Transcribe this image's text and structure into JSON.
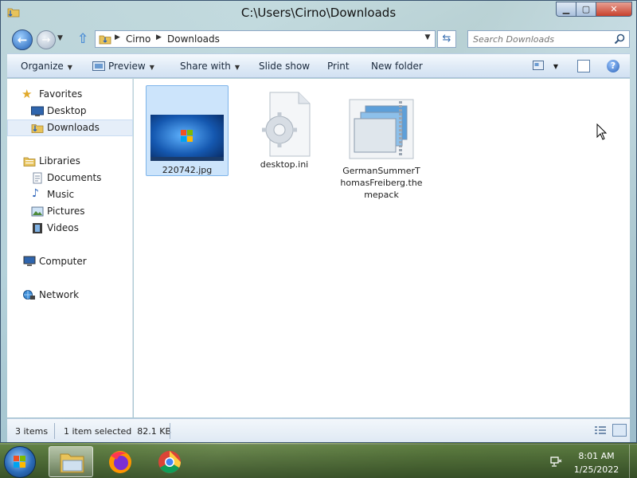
{
  "window": {
    "title": "C:\\Users\\Cirno\\Downloads",
    "minimize_glyph": "▁",
    "maximize_glyph": "▢",
    "close_glyph": "✕"
  },
  "navigation": {
    "back_glyph": "←",
    "forward_glyph": "→",
    "up_glyph": "⇧",
    "refresh_glyph": "⇆",
    "breadcrumb": [
      "Cirno",
      "Downloads"
    ],
    "search_placeholder": "Search Downloads"
  },
  "command_bar": {
    "organize": "Organize",
    "preview": "Preview",
    "share_with": "Share with",
    "slide_show": "Slide show",
    "print": "Print",
    "new_folder": "New folder",
    "help_glyph": "?"
  },
  "sidebar": {
    "favorites": {
      "label": "Favorites",
      "items": [
        {
          "label": "Desktop",
          "icon": "desktop-icon"
        },
        {
          "label": "Downloads",
          "icon": "downloads-folder-icon",
          "selected": true
        }
      ]
    },
    "libraries": {
      "label": "Libraries",
      "items": [
        {
          "label": "Documents",
          "icon": "documents-icon"
        },
        {
          "label": "Music",
          "icon": "music-icon"
        },
        {
          "label": "Pictures",
          "icon": "pictures-icon"
        },
        {
          "label": "Videos",
          "icon": "videos-icon"
        }
      ]
    },
    "computer": {
      "label": "Computer",
      "icon": "computer-icon"
    },
    "network": {
      "label": "Network",
      "icon": "network-icon"
    }
  },
  "files": [
    {
      "name": "220742.jpg",
      "type": "image",
      "selected": true
    },
    {
      "name": "desktop.ini",
      "type": "settings-file",
      "selected": false
    },
    {
      "name": "GermanSummerThomasFreiberg.themepack",
      "type": "themepack",
      "selected": false
    }
  ],
  "status": {
    "item_count": "3 items",
    "selection": "1 item selected  82.1 KB"
  },
  "taskbar": {
    "pinned": [
      "Windows Explorer",
      "Firefox",
      "Chrome"
    ],
    "time": "8:01 AM",
    "date": "1/25/2022"
  },
  "colors": {
    "selection": "#cce4fb",
    "accent": "#2a62b8"
  }
}
